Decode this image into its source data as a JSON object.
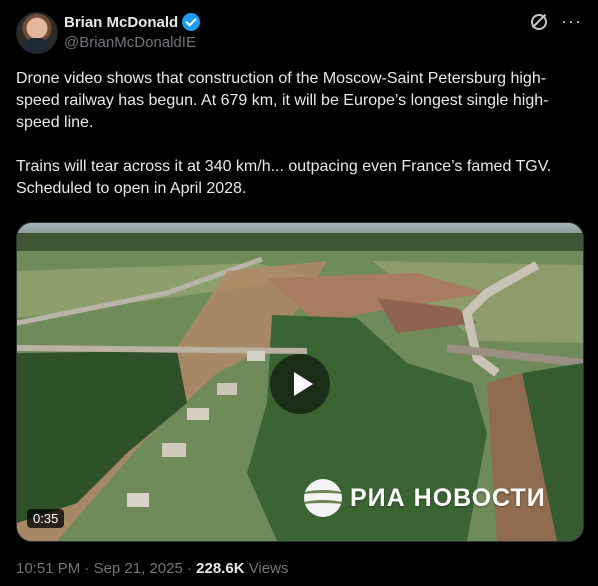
{
  "author": {
    "name": "Brian McDonald",
    "handle": "@BrianMcDonaldIE"
  },
  "tweet": {
    "paragraphs": [
      "Drone video shows that construction of the Moscow-Saint Petersburg high-speed railway has begun. At 679 km, it will be Europe’s longest single high-speed line.",
      "Trains will tear across it at 340 km/h... outpacing even France’s famed TGV. Scheduled to open in April 2028."
    ]
  },
  "video": {
    "duration": "0:35",
    "watermark": "РИА НОВОСТИ"
  },
  "meta": {
    "time": "10:51 PM",
    "separator1": "·",
    "date": "Sep 21, 2025",
    "separator2": "·",
    "views_count": "228.6K",
    "views_label": "Views"
  },
  "icons": {
    "verified": "verified-badge",
    "grok": "grok-icon",
    "more": "more-icon"
  },
  "colors": {
    "background": "#000000",
    "text": "#e7e9ea",
    "muted": "#71767b",
    "verified": "#1d9bf0"
  }
}
